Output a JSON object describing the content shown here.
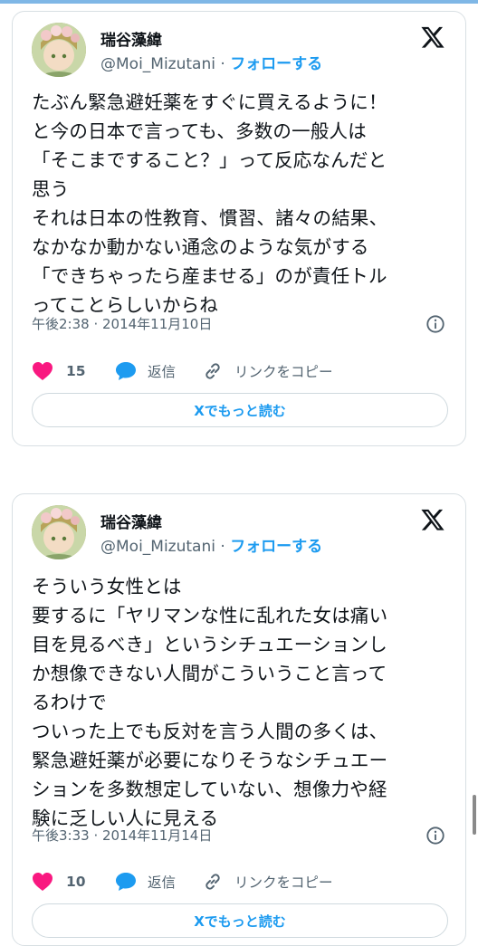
{
  "tweets": [
    {
      "display_name": "瑞谷藻緯",
      "handle": "@Moi_Mizutani",
      "separator": "·",
      "follow_label": "フォローする",
      "text": "たぶん緊急避妊薬をすぐに買えるように！\nと今の日本で言っても、多数の一般人は\n「そこまですること？」って反応なんだと\n思う\nそれは日本の性教育、慣習、諸々の結果、\nなかなか動かない通念のような気がする\n「できちゃったら産ませる」のが責任トル\nってことらしいからね",
      "timestamp": "午後2:38 · 2014年11月10日",
      "likes": "15",
      "reply_label": "返信",
      "copy_link_label": "リンクをコピー",
      "read_more_label": "Xでもっと読む"
    },
    {
      "display_name": "瑞谷藻緯",
      "handle": "@Moi_Mizutani",
      "separator": "·",
      "follow_label": "フォローする",
      "text": "そういう女性とは\n要するに「ヤリマンな性に乱れた女は痛い\n目を見るべき」というシチュエーションし\nか想像できない人間がこういうこと言って\nるわけで\nついった上でも反対を言う人間の多くは、\n緊急避妊薬が必要になりそうなシチュエー\nションを多数想定していない、想像力や経\n験に乏しい人に見える",
      "timestamp": "午後3:33 · 2014年11月14日",
      "likes": "10",
      "reply_label": "返信",
      "copy_link_label": "リンクをコピー",
      "read_more_label": "Xでもっと読む"
    }
  ],
  "colors": {
    "accent": "#1d9bf0",
    "like": "#f91880",
    "text": "#0f1419",
    "muted": "#536471",
    "border": "#cfd9de"
  },
  "icons": [
    "x-logo-icon",
    "info-icon",
    "heart-icon",
    "reply-bubble-icon",
    "link-icon"
  ]
}
